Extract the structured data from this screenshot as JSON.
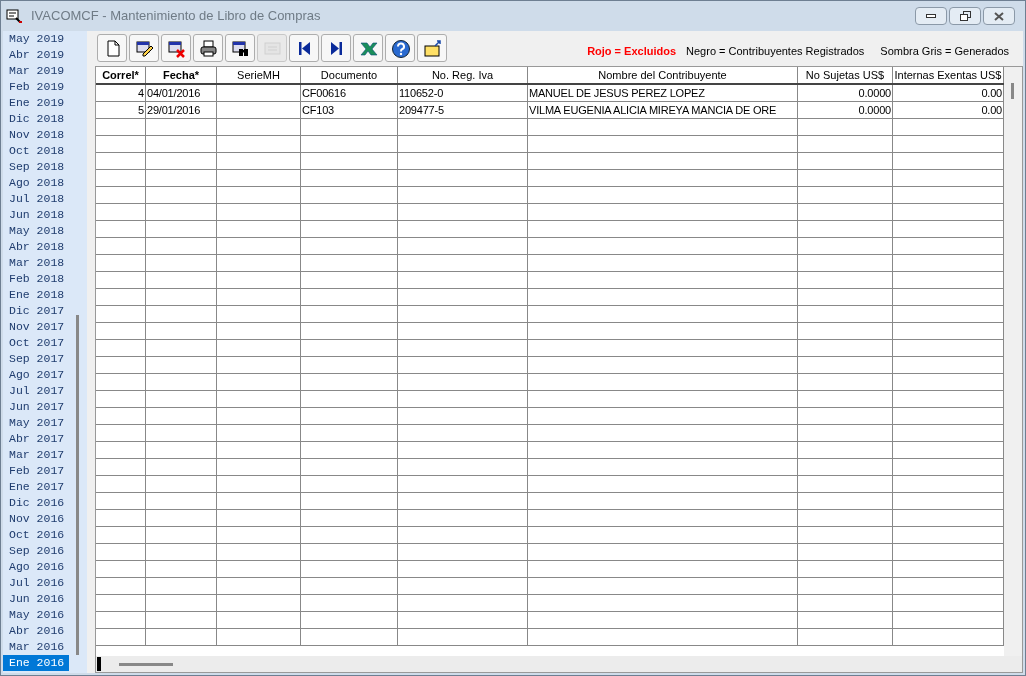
{
  "window": {
    "title": "IVACOMCF - Mantenimiento de Libro de Compras"
  },
  "periods": [
    {
      "label": "May 2019",
      "selected": false
    },
    {
      "label": "Abr 2019",
      "selected": false
    },
    {
      "label": "Mar 2019",
      "selected": false
    },
    {
      "label": "Feb 2019",
      "selected": false
    },
    {
      "label": "Ene 2019",
      "selected": false
    },
    {
      "label": "Dic 2018",
      "selected": false
    },
    {
      "label": "Nov 2018",
      "selected": false
    },
    {
      "label": "Oct 2018",
      "selected": false
    },
    {
      "label": "Sep 2018",
      "selected": false
    },
    {
      "label": "Ago 2018",
      "selected": false
    },
    {
      "label": "Jul 2018",
      "selected": false
    },
    {
      "label": "Jun 2018",
      "selected": false
    },
    {
      "label": "May 2018",
      "selected": false
    },
    {
      "label": "Abr 2018",
      "selected": false
    },
    {
      "label": "Mar 2018",
      "selected": false
    },
    {
      "label": "Feb 2018",
      "selected": false
    },
    {
      "label": "Ene 2018",
      "selected": false
    },
    {
      "label": "Dic 2017",
      "selected": false
    },
    {
      "label": "Nov 2017",
      "selected": false
    },
    {
      "label": "Oct 2017",
      "selected": false
    },
    {
      "label": "Sep 2017",
      "selected": false
    },
    {
      "label": "Ago 2017",
      "selected": false
    },
    {
      "label": "Jul 2017",
      "selected": false
    },
    {
      "label": "Jun 2017",
      "selected": false
    },
    {
      "label": "May 2017",
      "selected": false
    },
    {
      "label": "Abr 2017",
      "selected": false
    },
    {
      "label": "Mar 2017",
      "selected": false
    },
    {
      "label": "Feb 2017",
      "selected": false
    },
    {
      "label": "Ene 2017",
      "selected": false
    },
    {
      "label": "Dic 2016",
      "selected": false
    },
    {
      "label": "Nov 2016",
      "selected": false
    },
    {
      "label": "Oct 2016",
      "selected": false
    },
    {
      "label": "Sep 2016",
      "selected": false
    },
    {
      "label": "Ago 2016",
      "selected": false
    },
    {
      "label": "Jul 2016",
      "selected": false
    },
    {
      "label": "Jun 2016",
      "selected": false
    },
    {
      "label": "May 2016",
      "selected": false
    },
    {
      "label": "Abr 2016",
      "selected": false
    },
    {
      "label": "Mar 2016",
      "selected": false
    },
    {
      "label": "Ene 2016",
      "selected": true
    }
  ],
  "toolbar": [
    {
      "kind": "new",
      "disabled": false
    },
    {
      "kind": "edit",
      "disabled": false
    },
    {
      "kind": "delete",
      "disabled": false
    },
    {
      "kind": "print",
      "disabled": false
    },
    {
      "kind": "find",
      "disabled": false
    },
    {
      "kind": "calc",
      "disabled": true
    },
    {
      "kind": "first",
      "disabled": false
    },
    {
      "kind": "last",
      "disabled": false
    },
    {
      "kind": "excel",
      "disabled": false
    },
    {
      "kind": "help",
      "disabled": false
    },
    {
      "kind": "exit",
      "disabled": false
    }
  ],
  "legend": [
    {
      "text": "Rojo = Excluidos",
      "color": "#ff0000"
    },
    {
      "text": "Negro = Contribuyentes Registrados",
      "color": "#000000"
    },
    {
      "text": "Sombra Gris = Generados",
      "color": "#000000"
    }
  ],
  "table": {
    "columns": [
      "Correl*",
      "Fecha*",
      "SerieMH",
      "Documento",
      "No. Reg. Iva",
      "Nombre del Contribuyente",
      "No Sujetas US$",
      "Internas Exentas US$"
    ],
    "rows": [
      [
        "4",
        "04/01/2016",
        "",
        "CF00616",
        "110652-0",
        "MANUEL DE JESUS PEREZ LOPEZ",
        "0.0000",
        "0.00"
      ],
      [
        "5",
        "29/01/2016",
        "",
        "CF103",
        "209477-5",
        "VILMA EUGENIA ALICIA MIREYA MANCIA DE ORE",
        "0.0000",
        "0.00"
      ]
    ]
  }
}
